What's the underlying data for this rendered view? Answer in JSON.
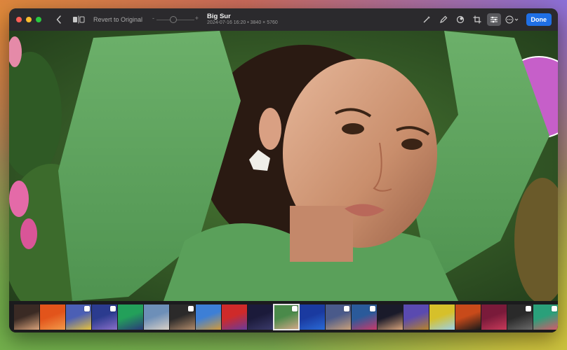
{
  "window": {
    "title": "Big Sur",
    "subtitle": "2024-07-16 16:20 • 3840 × 5760",
    "revert_label": "Revert to Original",
    "done_label": "Done"
  },
  "toolbar": {
    "left_icons": [
      "back-icon",
      "compare-icon"
    ],
    "slider_minus": "-",
    "slider_plus": "+",
    "right_icons": [
      "magic-wand-icon",
      "retouch-icon",
      "filters-icon",
      "crop-icon",
      "adjust-icon",
      "more-icon"
    ],
    "accent": "#1f6fe5"
  },
  "filmstrip": {
    "count": 21,
    "selected_index": 10,
    "thumbs": [
      {
        "c1": "#3a2a24",
        "c2": "#d9a27a",
        "badge": false
      },
      {
        "c1": "#e2541b",
        "c2": "#f39a4a",
        "badge": false
      },
      {
        "c1": "#4b5fb5",
        "c2": "#e7c23d",
        "badge": true
      },
      {
        "c1": "#2b3b8f",
        "c2": "#8a6fc9",
        "badge": true
      },
      {
        "c1": "#23a05a",
        "c2": "#2a3a7a",
        "badge": false
      },
      {
        "c1": "#6d8fb8",
        "c2": "#d8d0c6",
        "badge": false
      },
      {
        "c1": "#2b2a2a",
        "c2": "#b08a6a",
        "badge": true
      },
      {
        "c1": "#3d7fd6",
        "c2": "#d29a3a",
        "badge": false
      },
      {
        "c1": "#cf2a2a",
        "c2": "#6b3a9a",
        "badge": false
      },
      {
        "c1": "#1b1a3a",
        "c2": "#3a3a6a",
        "badge": false
      },
      {
        "c1": "#4a8a4a",
        "c2": "#d6a88a",
        "badge": true
      },
      {
        "c1": "#1a3aa0",
        "c2": "#2a6ad6",
        "badge": false
      },
      {
        "c1": "#4a5a8a",
        "c2": "#c9a07a",
        "badge": true
      },
      {
        "c1": "#2a5a9a",
        "c2": "#c93a6a",
        "badge": true
      },
      {
        "c1": "#1a1a2a",
        "c2": "#d6a27a",
        "badge": false
      },
      {
        "c1": "#5a4ab0",
        "c2": "#b8842a",
        "badge": false
      },
      {
        "c1": "#d6c02a",
        "c2": "#9bd0e8",
        "badge": false
      },
      {
        "c1": "#c84a1a",
        "c2": "#1a1a1a",
        "badge": false
      },
      {
        "c1": "#7a1a3a",
        "c2": "#c83a5a",
        "badge": false
      },
      {
        "c1": "#2a2a2a",
        "c2": "#6a6a6a",
        "badge": true
      },
      {
        "c1": "#2aa07a",
        "c2": "#d65a6a",
        "badge": true
      }
    ]
  }
}
